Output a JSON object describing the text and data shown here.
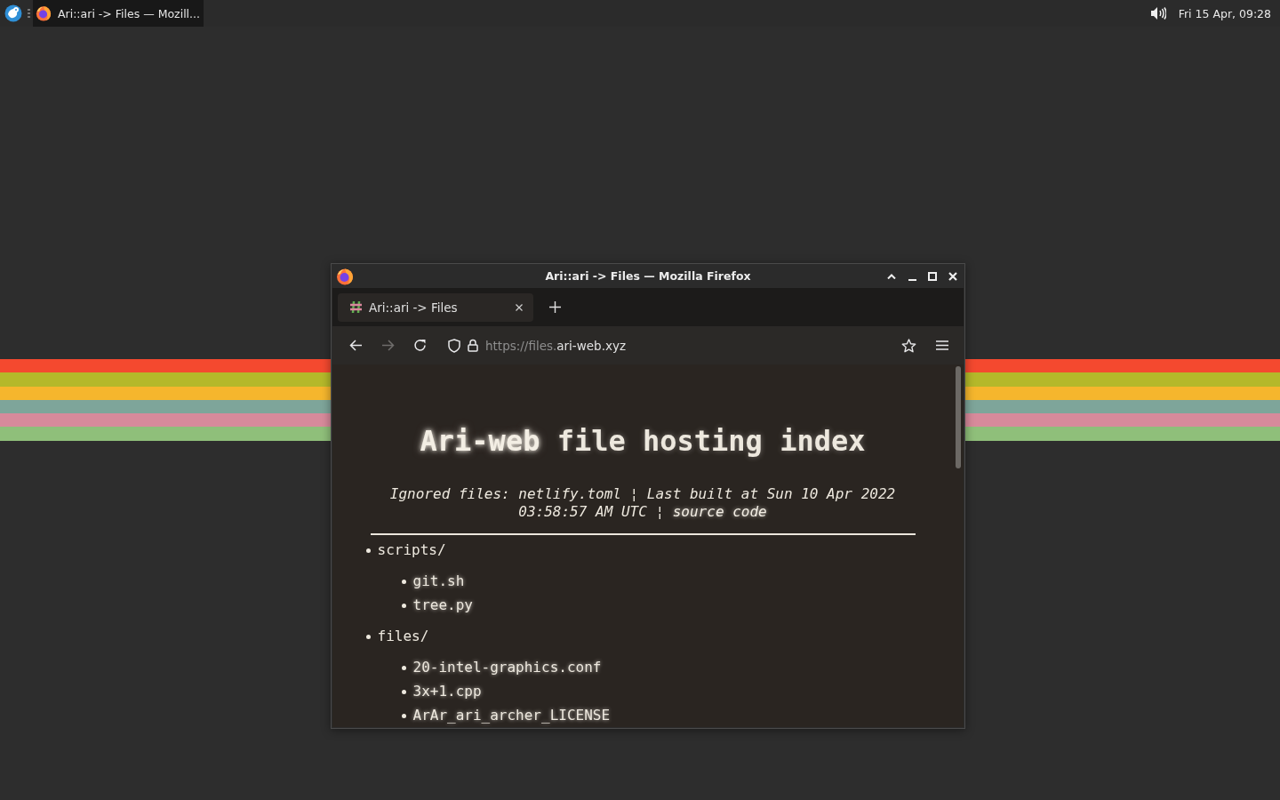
{
  "top_bar": {
    "taskbar": [
      {
        "label": "Ari::ari -> Files — Mozill...",
        "selected": true
      }
    ],
    "clock": "Fri 15 Apr, 09:28"
  },
  "window": {
    "title": "Ari::ari -> Files — Mozilla Firefox"
  },
  "tabs": [
    {
      "label": "Ari::ari -> Files",
      "selected": true
    }
  ],
  "toolbar": {
    "back": {
      "disabled": false
    },
    "forward": {
      "disabled": true
    },
    "url": {
      "prefix": "https://files.",
      "domain": "ari-web.xyz"
    }
  },
  "page": {
    "heading": {
      "link": "Ari-web",
      "text": "file hosting index"
    },
    "info": {
      "text": "Ignored files: netlify.toml ¦ Last built at Sun 10 Apr 2022 03:58:57 AM UTC ¦",
      "link": "source code"
    },
    "tree": [
      {
        "name": "scripts/",
        "children": [
          {
            "name": "git.sh"
          },
          {
            "name": "tree.py"
          }
        ]
      },
      {
        "name": "files/",
        "children": [
          {
            "name": "20-intel-graphics.conf"
          },
          {
            "name": "3x+1.cpp"
          },
          {
            "name": "ArAr_ari_archer_LICENSE"
          }
        ]
      }
    ]
  }
}
